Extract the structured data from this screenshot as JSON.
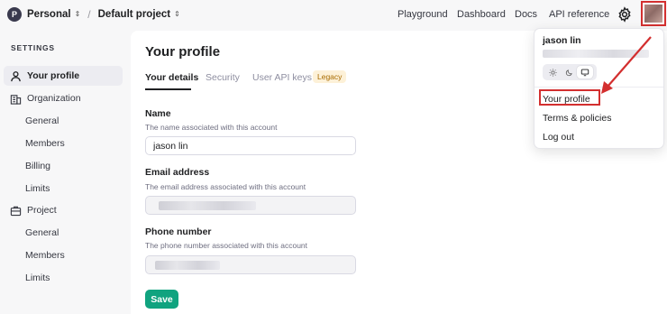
{
  "topbar": {
    "org_initial": "P",
    "org_name": "Personal",
    "project_name": "Default project",
    "nav": [
      "Playground",
      "Dashboard",
      "Docs",
      "API reference"
    ]
  },
  "sidebar": {
    "heading": "SETTINGS",
    "your_profile": "Your profile",
    "organization": "Organization",
    "org_items": [
      "General",
      "Members",
      "Billing",
      "Limits"
    ],
    "project": "Project",
    "project_items": [
      "General",
      "Members",
      "Limits"
    ]
  },
  "main": {
    "title": "Your profile",
    "tabs": [
      "Your details",
      "Security",
      "User API keys"
    ],
    "legacy_badge": "Legacy",
    "name_label": "Name",
    "name_help": "The name associated with this account",
    "name_value": "jason lin",
    "email_label": "Email address",
    "email_help": "The email address associated with this account",
    "phone_label": "Phone number",
    "phone_help": "The phone number associated with this account",
    "save_label": "Save"
  },
  "dropdown": {
    "user_name": "jason lin",
    "items": [
      "Your profile",
      "Terms & policies",
      "Log out"
    ],
    "theme_options": [
      "sun-icon",
      "moon-icon",
      "monitor-icon"
    ],
    "selected_theme": "monitor-icon"
  },
  "colors": {
    "accent": "#10a37f",
    "annotation": "#d32f2f"
  }
}
